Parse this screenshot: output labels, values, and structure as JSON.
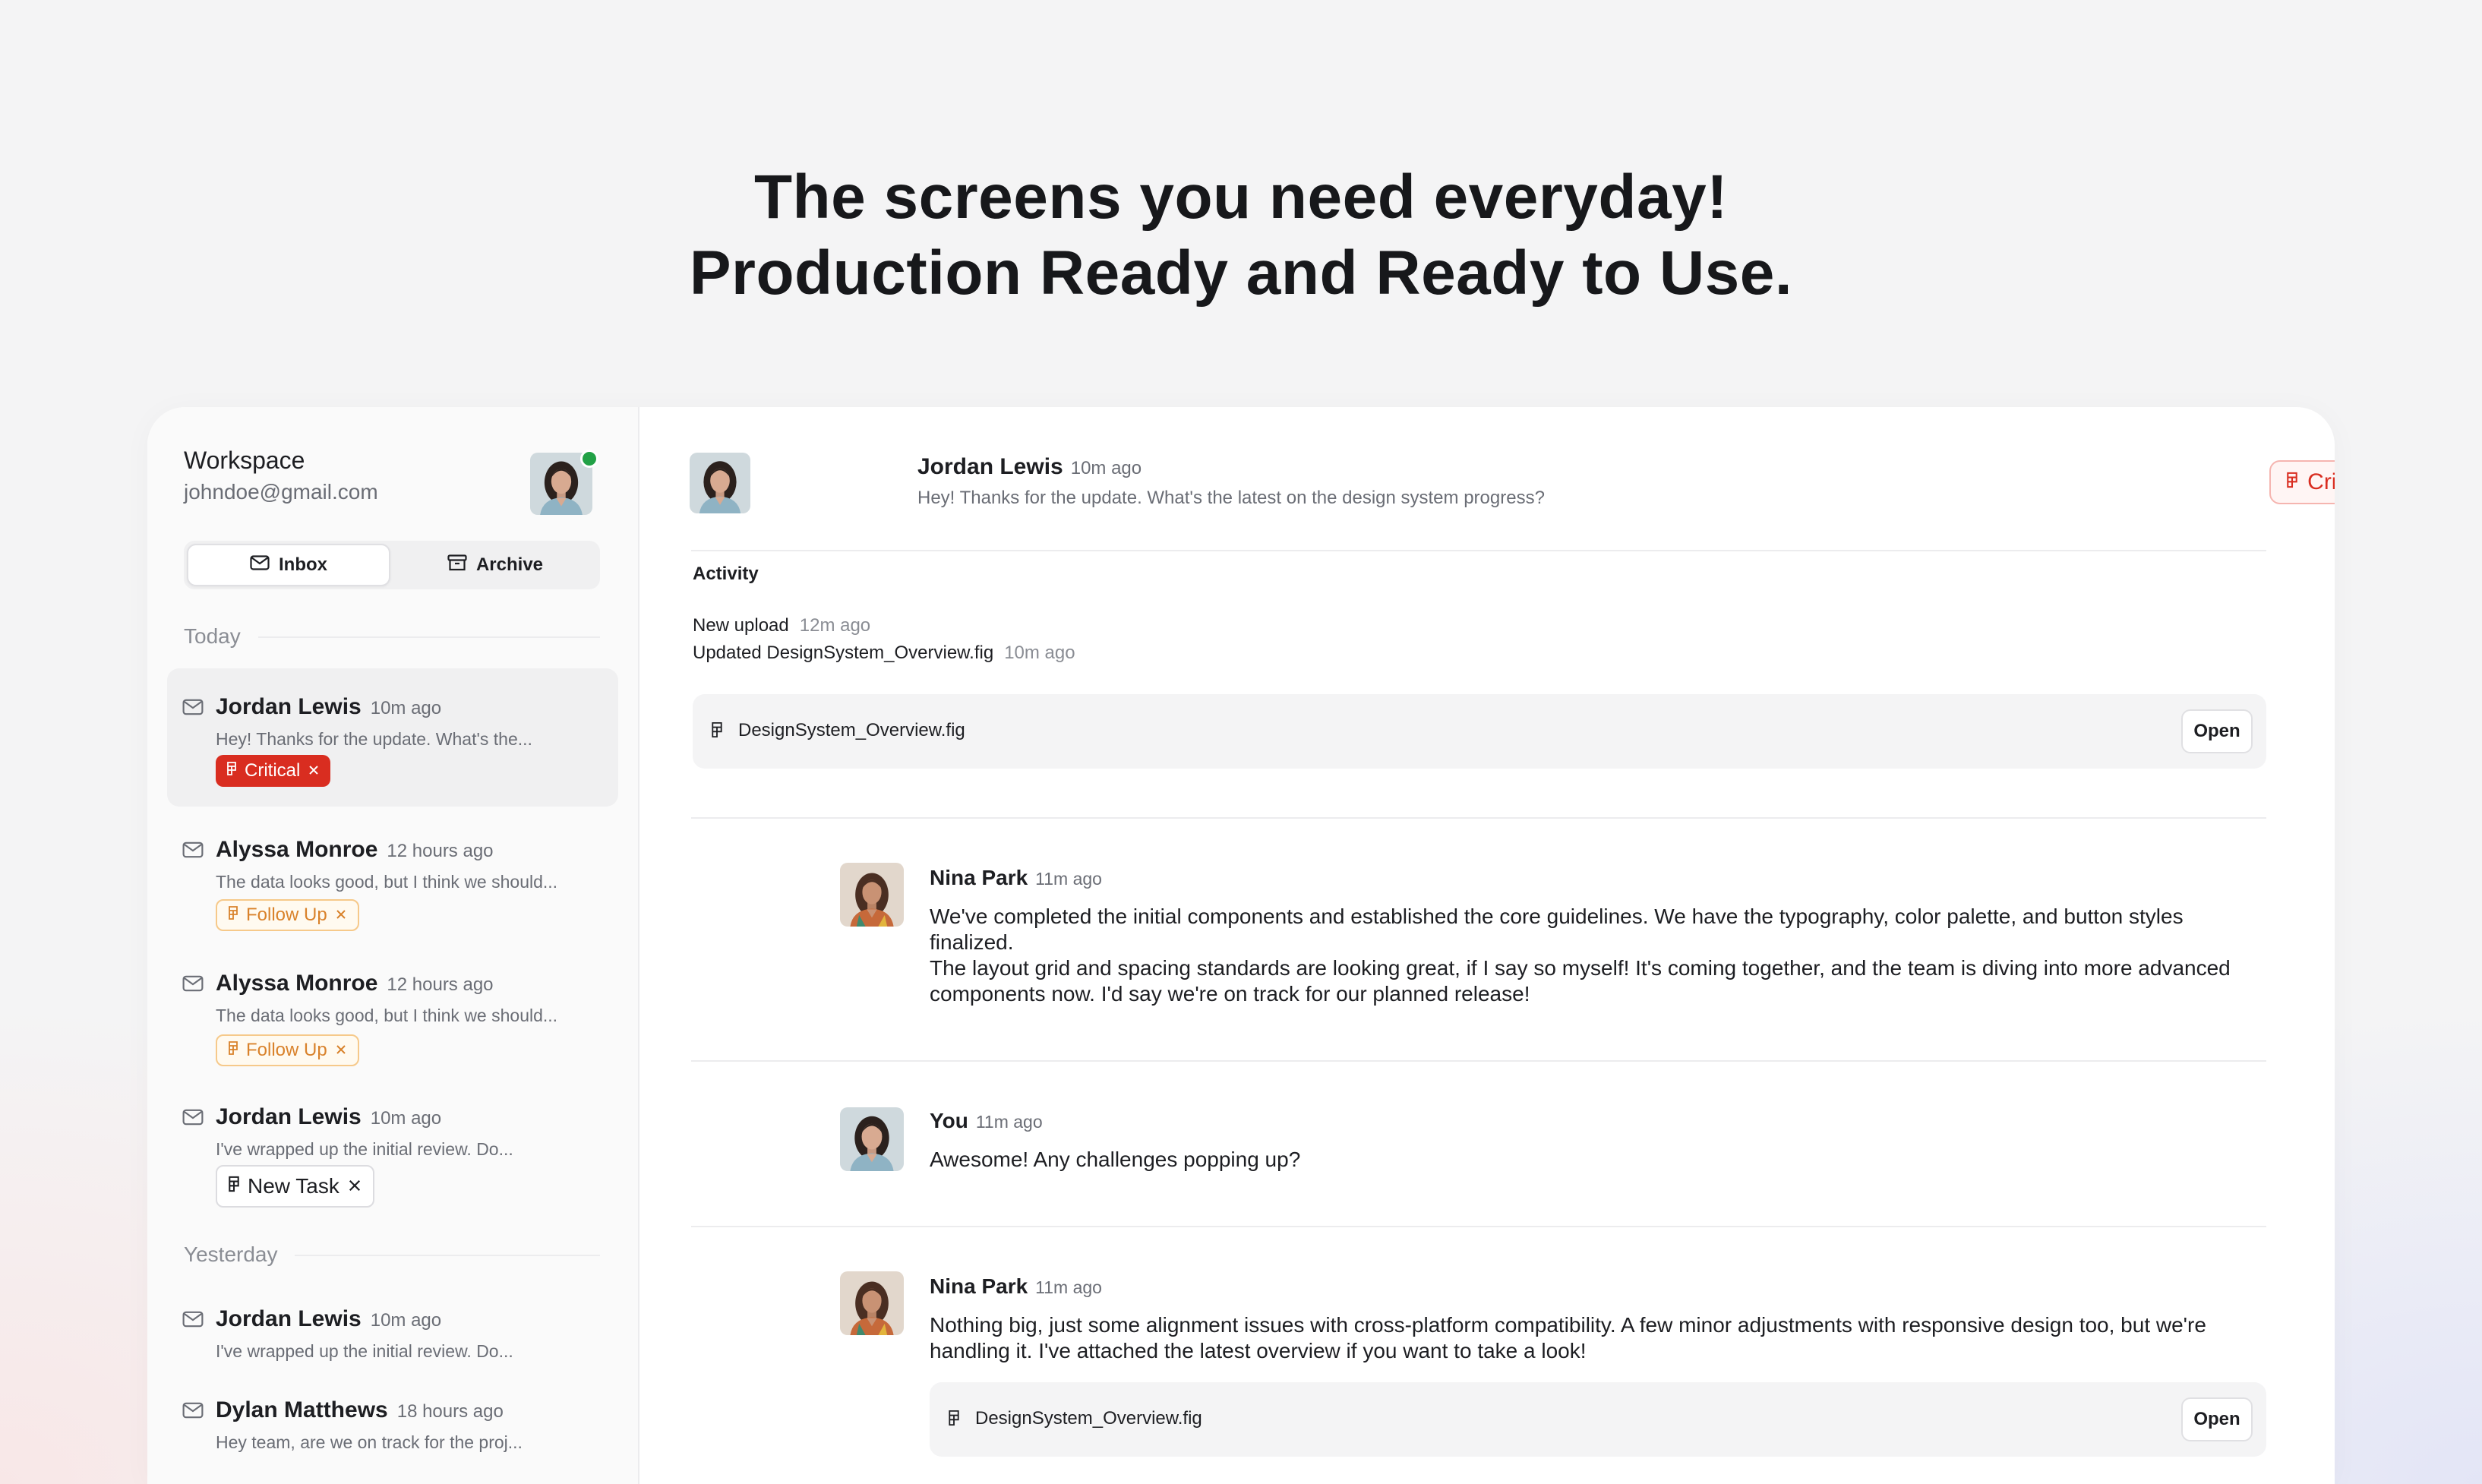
{
  "hero": {
    "line1": "The screens you need everyday!",
    "line2": "Production Ready and Ready to Use."
  },
  "sidebar": {
    "workspace": "Workspace",
    "email": "johndoe@gmail.com",
    "tabs": {
      "inbox": "Inbox",
      "archive": "Archive"
    },
    "sections": {
      "today": "Today",
      "yesterday": "Yesterday"
    },
    "items": [
      {
        "sender": "Jordan Lewis",
        "time": "10m ago",
        "preview": "Hey! Thanks for the update. What's the...",
        "tag": "Critical"
      },
      {
        "sender": "Alyssa Monroe",
        "time": "12 hours ago",
        "preview": "The data looks good, but I think we  should...",
        "tag": "Follow Up"
      },
      {
        "sender": "Alyssa Monroe",
        "time": "12 hours ago",
        "preview": "The data looks good, but I think we  should...",
        "tag": "Follow Up"
      },
      {
        "sender": "Jordan Lewis",
        "time": "10m ago",
        "preview": "I've wrapped up the initial review. Do...",
        "tag": "New Task"
      },
      {
        "sender": "Jordan Lewis",
        "time": "10m ago",
        "preview": "I've wrapped up the initial review. Do..."
      },
      {
        "sender": "Dylan Matthews",
        "time": "18 hours ago",
        "preview": "Hey team, are we on track for the proj..."
      }
    ]
  },
  "thread": {
    "header": {
      "sender": "Jordan Lewis",
      "time": "10m ago",
      "message": "Hey! Thanks for the update. What's the latest on the design system progress?",
      "tag": "Critical"
    },
    "activity": {
      "title": "Activity",
      "rows": [
        {
          "text": "New upload",
          "time": "12m ago"
        },
        {
          "text": "Updated DesignSystem_Overview.fig",
          "time": "10m ago"
        }
      ],
      "file": "DesignSystem_Overview.fig",
      "open_label": "Open"
    },
    "messages": [
      {
        "sender": "Nina Park",
        "time": "11m ago",
        "p1": "We've completed the initial components and established the core guidelines. We have the typography, color palette, and button styles finalized.",
        "p2": "The layout grid and spacing standards are looking great, if I say so myself! It's coming together, and the team is diving into more advanced components now. I'd say we're on track for our planned release!"
      },
      {
        "sender": "You",
        "time": "11m ago",
        "p1": "Awesome! Any challenges popping up?"
      },
      {
        "sender": "Nina Park",
        "time": "11m ago",
        "p1": "Nothing big, just some alignment issues with cross-platform compatibility. A few minor adjustments with responsive design too, but we're handling it. I've attached the latest overview if you want to take a look!",
        "file": "DesignSystem_Overview.fig",
        "open_label": "Open"
      }
    ]
  },
  "colors": {
    "critical": "#d92d20",
    "follow_up": "#d9822b",
    "online": "#22a146"
  },
  "icons": [
    "mail-icon",
    "archive-icon",
    "figma-icon",
    "close-icon",
    "chevron-down-icon"
  ]
}
